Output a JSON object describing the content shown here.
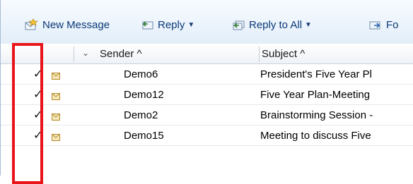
{
  "toolbar": {
    "new_message": "New Message",
    "reply": "Reply",
    "reply_all": "Reply to All",
    "forward": "Fo"
  },
  "header": {
    "sender": "Sender ^",
    "subject": "Subject ^"
  },
  "rows": [
    {
      "checked": "✓",
      "sender": "Demo6",
      "subject": "President's Five Year Pl"
    },
    {
      "checked": "✓",
      "sender": "Demo12",
      "subject": "Five Year Plan-Meeting"
    },
    {
      "checked": "✓",
      "sender": "Demo2",
      "subject": "Brainstorming Session -"
    },
    {
      "checked": "✓",
      "sender": "Demo15",
      "subject": "Meeting to discuss Five"
    }
  ],
  "colors": {
    "highlight": "#e8151b",
    "toolbar_text": "#0b3a78"
  }
}
